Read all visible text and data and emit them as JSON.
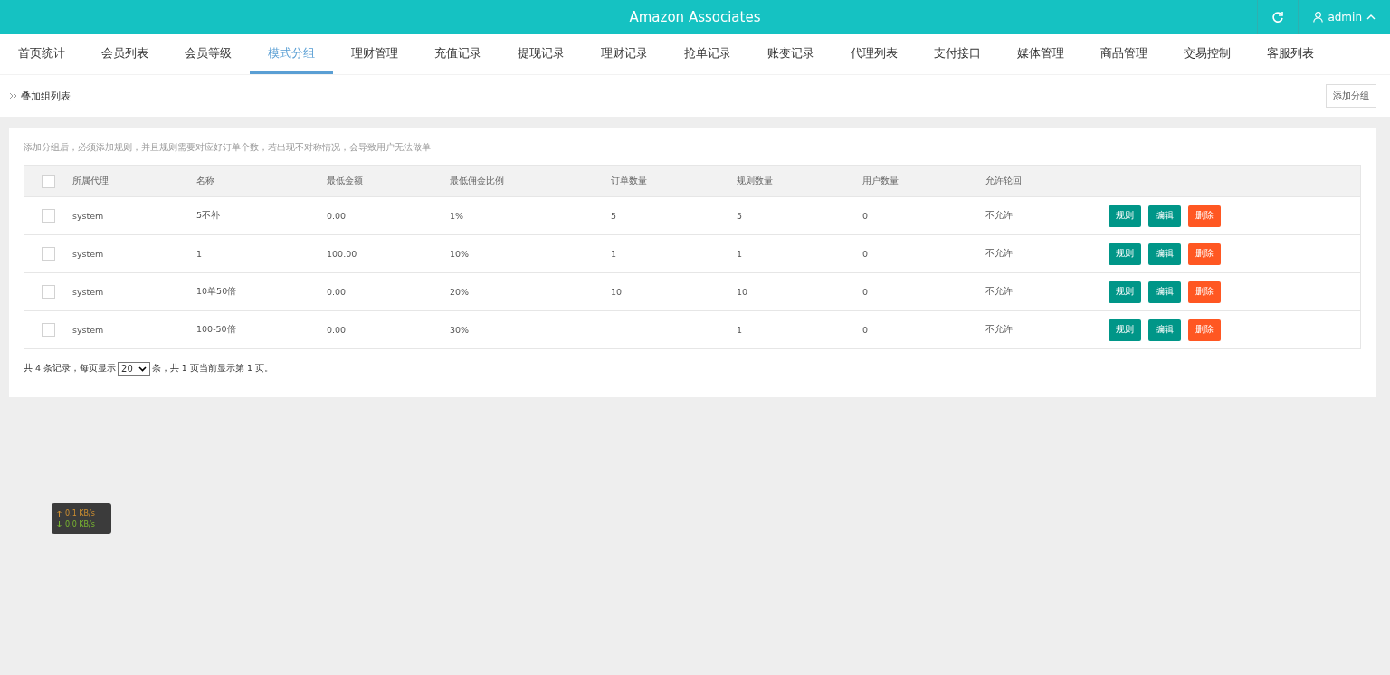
{
  "header": {
    "title": "Amazon Associates",
    "user": "admin"
  },
  "nav": [
    {
      "label": "首页统计",
      "selected": false
    },
    {
      "label": "会员列表",
      "selected": false
    },
    {
      "label": "会员等级",
      "selected": false
    },
    {
      "label": "模式分组",
      "selected": true
    },
    {
      "label": "理财管理",
      "selected": false
    },
    {
      "label": "充值记录",
      "selected": false
    },
    {
      "label": "提现记录",
      "selected": false
    },
    {
      "label": "理财记录",
      "selected": false
    },
    {
      "label": "抢单记录",
      "selected": false
    },
    {
      "label": "账变记录",
      "selected": false
    },
    {
      "label": "代理列表",
      "selected": false
    },
    {
      "label": "支付接口",
      "selected": false
    },
    {
      "label": "媒体管理",
      "selected": false
    },
    {
      "label": "商品管理",
      "selected": false
    },
    {
      "label": "交易控制",
      "selected": false
    },
    {
      "label": "客服列表",
      "selected": false
    }
  ],
  "breadcrumb": "叠加组列表",
  "add_button": "添加分组",
  "hint": "添加分组后，必须添加规则，并且规则需要对应好订单个数，若出现不对称情况，会导致用户无法做单",
  "table": {
    "select_all_checked": false,
    "columns": [
      "所属代理",
      "名称",
      "最低金额",
      "最低佣金比例",
      "订单数量",
      "规则数量",
      "用户数量",
      "允许轮回"
    ],
    "rows": [
      {
        "checked": false,
        "cells": [
          "system",
          "5不补",
          "0.00",
          "1%",
          "5",
          "5",
          "0",
          "不允许"
        ],
        "actions": [
          "规则",
          "编辑",
          "删除"
        ]
      },
      {
        "checked": false,
        "cells": [
          "system",
          "1",
          "100.00",
          "10%",
          "1",
          "1",
          "0",
          "不允许"
        ],
        "actions": [
          "规则",
          "编辑",
          "删除"
        ]
      },
      {
        "checked": false,
        "cells": [
          "system",
          "10单50倍",
          "0.00",
          "20%",
          "10",
          "10",
          "0",
          "不允许"
        ],
        "actions": [
          "规则",
          "编辑",
          "删除"
        ]
      },
      {
        "checked": false,
        "cells": [
          "system",
          "100-50倍",
          "0.00",
          "30%",
          "",
          "1",
          "0",
          "不允许"
        ],
        "actions": [
          "规则",
          "编辑",
          "删除"
        ]
      }
    ]
  },
  "pagination": {
    "before": "共 4 条记录，每页显示",
    "page_size": "20",
    "after": "条，共 1 页当前显示第 1 页。"
  },
  "net_speed": {
    "up": "0.1 KB/s",
    "down": "0.0 KB/s"
  }
}
